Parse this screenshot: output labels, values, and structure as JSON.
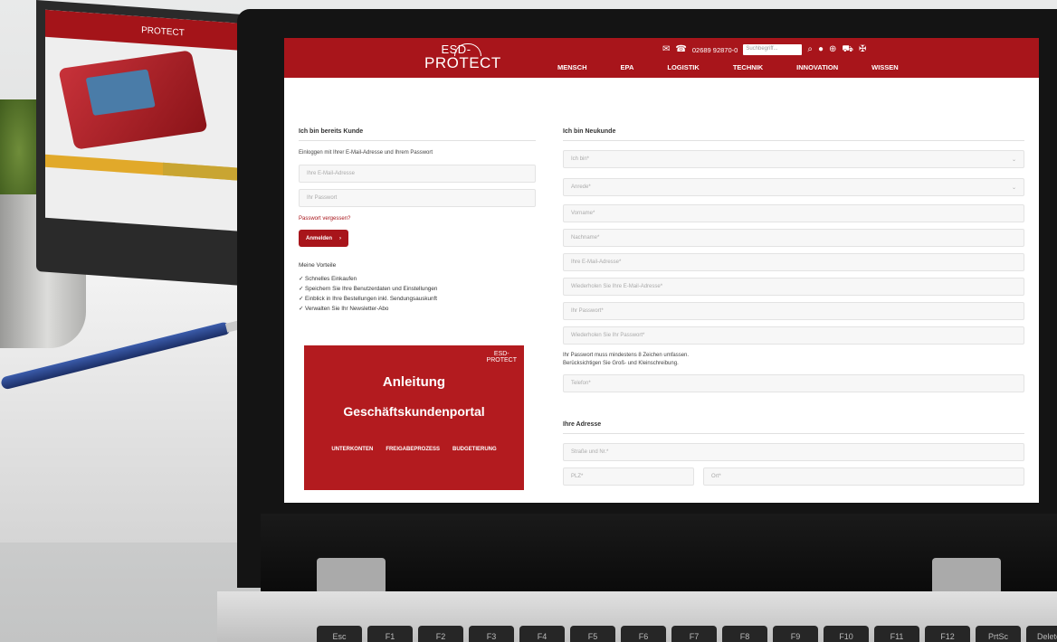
{
  "brand": {
    "line1": "ESD-",
    "line2": "PROTECT"
  },
  "header": {
    "phone": "02689 92870-0",
    "search_placeholder": "Suchbegriff...",
    "nav": [
      "MENSCH",
      "EPA",
      "LOGISTIK",
      "TECHNIK",
      "INNOVATION",
      "WISSEN"
    ]
  },
  "login": {
    "heading": "Ich bin bereits Kunde",
    "intro": "Einloggen mit Ihrer E-Mail-Adresse und Ihrem Passwort",
    "email_placeholder": "Ihre E-Mail-Adresse",
    "password_placeholder": "Ihr Passwort",
    "forgot": "Passwort vergessen?",
    "submit": "Anmelden",
    "submit_arrow": "›"
  },
  "benefits": {
    "heading": "Meine Vorteile",
    "items": [
      "✓  Schnelles Einkaufen",
      "✓  Speichern Sie Ihre Benutzerdaten und Einstellungen",
      "✓  Einblick in Ihre Bestellungen inkl. Sendungsauskunft",
      "✓  Verwalten Sie Ihr Newsletter-Abo"
    ]
  },
  "banner": {
    "logo1": "ESD-",
    "logo2": "PROTECT",
    "title1": "Anleitung",
    "title2": "Geschäftskundenportal",
    "tags": [
      "UNTERKONTEN",
      "FREIGABEPROZESS",
      "BUDGETIERUNG"
    ]
  },
  "register": {
    "heading": "Ich bin Neukunde",
    "fields": {
      "ich_bin": "Ich bin*",
      "anrede": "Anrede*",
      "vorname": "Vorname*",
      "nachname": "Nachname*",
      "email": "Ihre E-Mail-Adresse*",
      "email_repeat": "Wiederholen Sie Ihre E-Mail-Adresse*",
      "password": "Ihr Passwort*",
      "password_repeat": "Wiederholen Sie Ihr Passwort*",
      "telefon": "Telefon*"
    },
    "pw_hint1": "Ihr Passwort muss mindestens 8 Zeichen umfassen.",
    "pw_hint2": "Berücksichtigen Sie Groß- und Kleinschreibung.",
    "address_heading": "Ihre Adresse",
    "address": {
      "strasse": "Straße und Nr.*",
      "plz": "PLZ*",
      "ort": "Ort*"
    }
  },
  "keyboard": [
    "Esc",
    "F1",
    "F2",
    "F3",
    "F4",
    "F5",
    "F6",
    "F7",
    "F8",
    "F9",
    "F10",
    "F11",
    "F12",
    "PrtSc",
    "Delete"
  ]
}
